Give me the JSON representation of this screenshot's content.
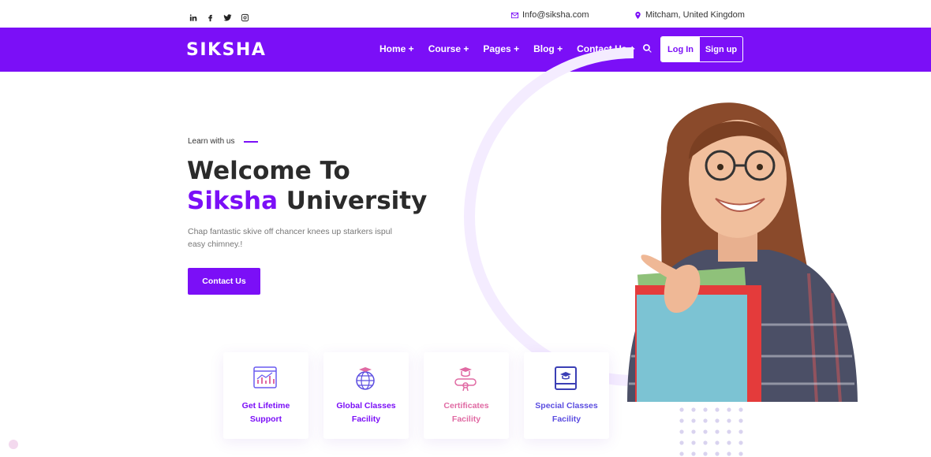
{
  "topbar": {
    "social": [
      "linkedin-icon",
      "facebook-icon",
      "twitter-icon",
      "instagram-icon"
    ],
    "email": "Info@siksha.com",
    "location": "Mitcham, United Kingdom"
  },
  "nav": {
    "logo": "SIKSHA",
    "items": [
      "Home +",
      "Course +",
      "Pages +",
      "Blog +",
      "Contact Us +"
    ],
    "login": "Log In",
    "signup": "Sign up"
  },
  "hero": {
    "kicker": "Learn with us",
    "title_line1": "Welcome To",
    "title_accent": "Siksha",
    "title_rest": " University",
    "description": "Chap fantastic skive off chancer knees up starkers ispul easy chimney.!",
    "cta": "Contact Us"
  },
  "features": [
    {
      "line1": "Get Lifetime",
      "line2": "Support",
      "icon": "chart-board-icon"
    },
    {
      "line1": "Global Classes",
      "line2": "Facility",
      "icon": "globe-cap-icon"
    },
    {
      "line1": "Certificates",
      "line2": "Facility",
      "icon": "certificate-icon"
    },
    {
      "line1": "Special Classes",
      "line2": "Facility",
      "icon": "book-cap-icon"
    }
  ],
  "colors": {
    "brand": "#7b0ff7",
    "pink": "#e06aa3",
    "indigo": "#5b4de0"
  }
}
